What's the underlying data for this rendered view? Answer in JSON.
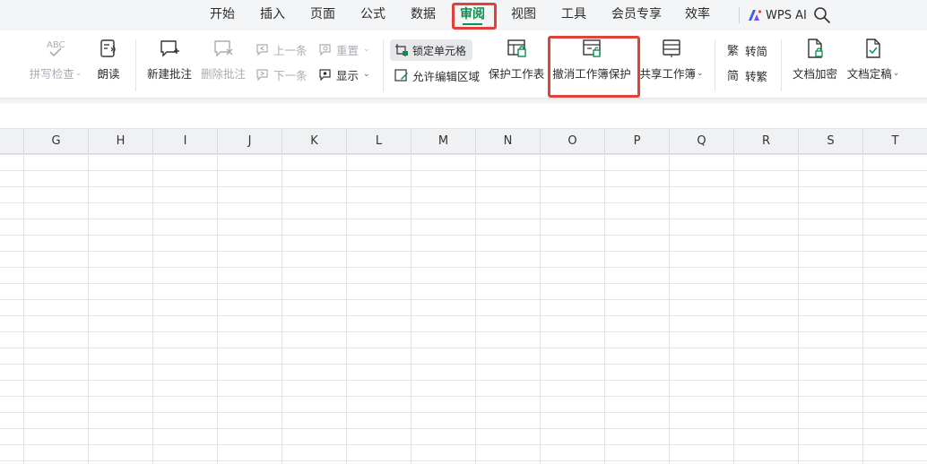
{
  "menu": {
    "tabs": [
      {
        "label": "开始"
      },
      {
        "label": "插入"
      },
      {
        "label": "页面"
      },
      {
        "label": "公式"
      },
      {
        "label": "数据"
      },
      {
        "label": "审阅",
        "active": true
      },
      {
        "label": "视图"
      },
      {
        "label": "工具"
      },
      {
        "label": "会员专享"
      },
      {
        "label": "效率"
      }
    ],
    "ai_label": "WPS AI",
    "search_icon": "search-icon"
  },
  "ribbon": {
    "spellcheck": {
      "label": "拼写检查",
      "disabled": true,
      "icon": "abc-spellcheck-icon"
    },
    "read_aloud": {
      "label": "朗读",
      "icon": "read-aloud-icon"
    },
    "new_comment": {
      "label": "新建批注",
      "icon": "new-comment-icon"
    },
    "delete_comment": {
      "label": "删除批注",
      "disabled": true,
      "icon": "delete-comment-icon"
    },
    "prev_comment": {
      "label": "上一条",
      "disabled": true,
      "icon": "previous-comment-icon"
    },
    "next_comment": {
      "label": "下一条",
      "disabled": true,
      "icon": "next-comment-icon"
    },
    "reset": {
      "label": "重置",
      "disabled": true,
      "icon": "reset-comment-icon"
    },
    "show": {
      "label": "显示",
      "icon": "show-comment-icon"
    },
    "lock_cells": {
      "label": "锁定单元格",
      "icon": "lock-cell-icon"
    },
    "allow_edit_ranges": {
      "label": "允许编辑区域",
      "icon": "edit-range-icon"
    },
    "protect_sheet": {
      "label": "保护工作表",
      "icon": "protect-sheet-icon"
    },
    "unprotect_workbook": {
      "label": "撤消工作簿保护",
      "icon": "unprotect-workbook-icon"
    },
    "share_workbook": {
      "label": "共享工作簿",
      "icon": "share-workbook-icon"
    },
    "to_simplified": {
      "label": "转简",
      "icon": "to-simplified-icon"
    },
    "to_traditional": {
      "label": "转繁",
      "icon": "to-traditional-icon"
    },
    "doc_encrypt": {
      "label": "文档加密",
      "icon": "document-encrypt-icon"
    },
    "doc_finalize": {
      "label": "文档定稿",
      "icon": "document-finalize-icon"
    }
  },
  "sheet": {
    "columns": [
      "G",
      "H",
      "I",
      "J",
      "K",
      "L",
      "M",
      "N",
      "O",
      "P",
      "Q",
      "R",
      "S",
      "T"
    ]
  },
  "colors": {
    "accent": "#0a8f4f",
    "highlight_box": "#e0413a"
  }
}
